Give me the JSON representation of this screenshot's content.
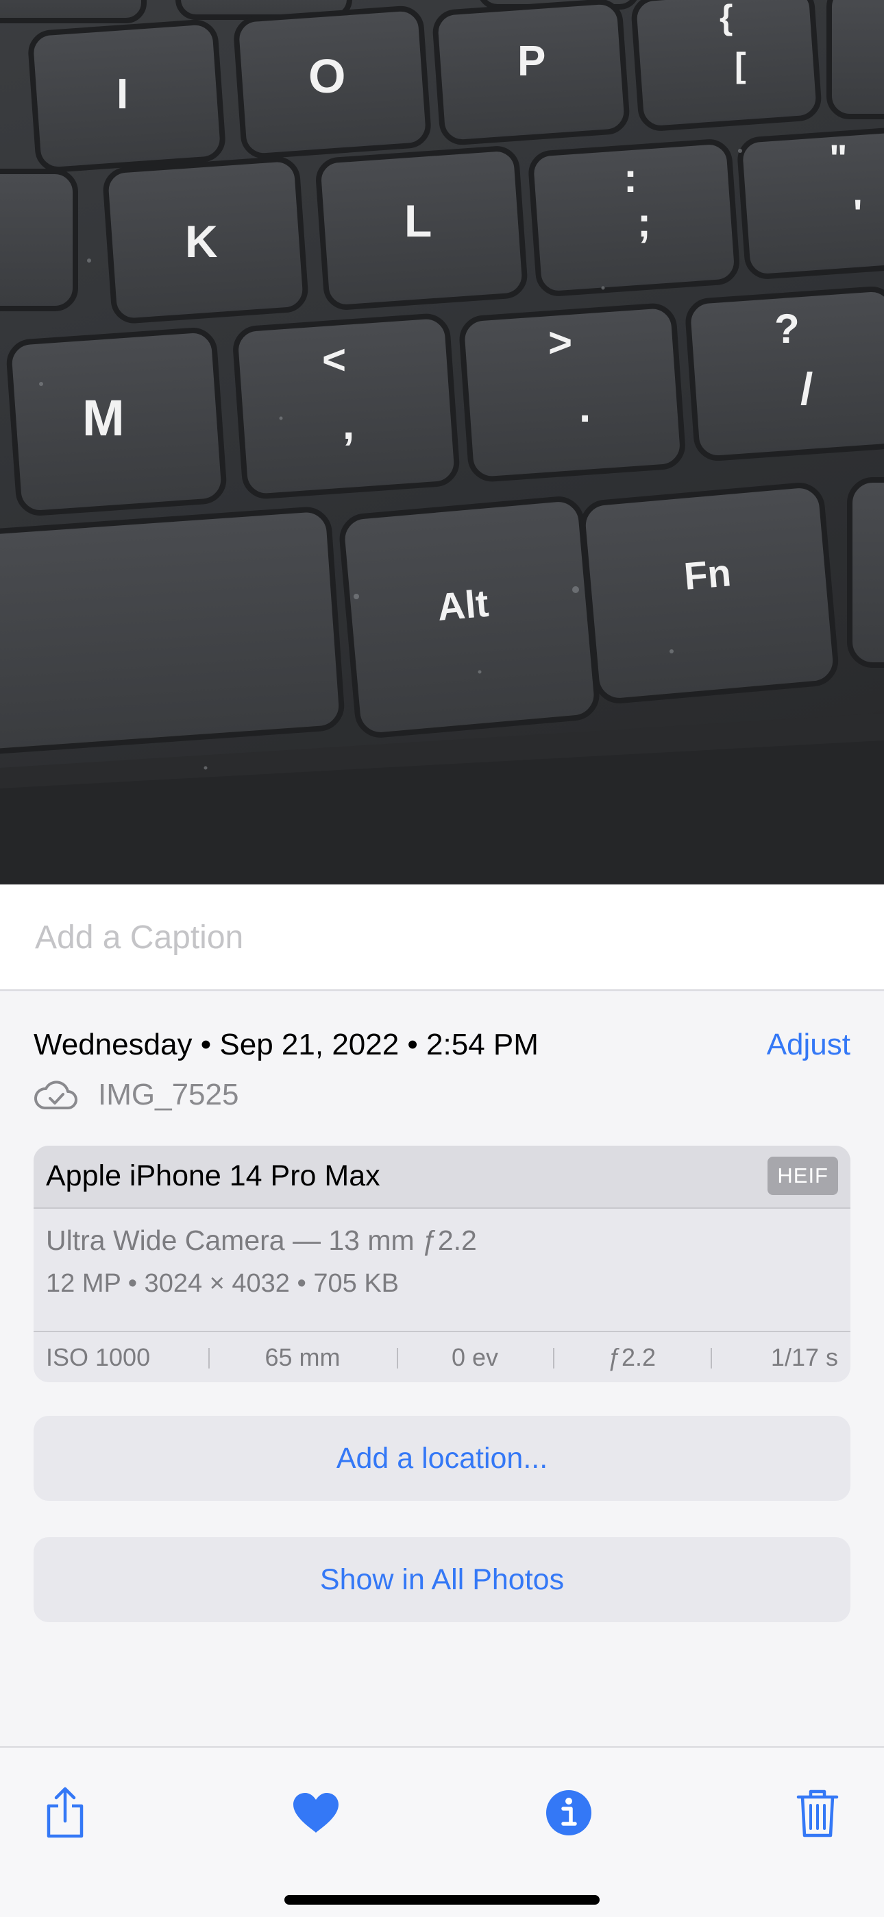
{
  "photo": {
    "keys": [
      "I",
      "O",
      "P",
      "K",
      "L",
      "M",
      "Alt",
      "Fn"
    ],
    "symbols": {
      "brace_bracket": [
        "{",
        "["
      ],
      "colon_semicolon": [
        ":",
        ";"
      ],
      "quote": [
        "\"",
        "'"
      ],
      "comma_lt": [
        "<",
        ","
      ],
      "period_gt": [
        ">",
        "."
      ],
      "slash_question": [
        "?",
        "/"
      ]
    }
  },
  "caption": {
    "placeholder": "Add a Caption"
  },
  "info": {
    "datetime": "Wednesday • Sep 21, 2022 • 2:54 PM",
    "adjust_label": "Adjust",
    "filename": "IMG_7525",
    "filename_icon": "cloud-check-icon",
    "camera": {
      "device": "Apple iPhone 14 Pro Max",
      "format": "HEIF",
      "lens": "Ultra Wide Camera — 13 mm ƒ2.2",
      "specs": "12 MP  •  3024 × 4032  •  705 KB",
      "exif": {
        "iso": "ISO 1000",
        "focal_length": "65 mm",
        "exposure_bias": "0 ev",
        "aperture": "ƒ2.2",
        "shutter": "1/17 s"
      }
    },
    "add_location_label": "Add a location...",
    "show_all_label": "Show in All Photos"
  },
  "toolbar": {
    "icons": [
      "share-icon",
      "heart-icon",
      "info-icon",
      "trash-icon"
    ],
    "accent_color": "#3478f6"
  }
}
